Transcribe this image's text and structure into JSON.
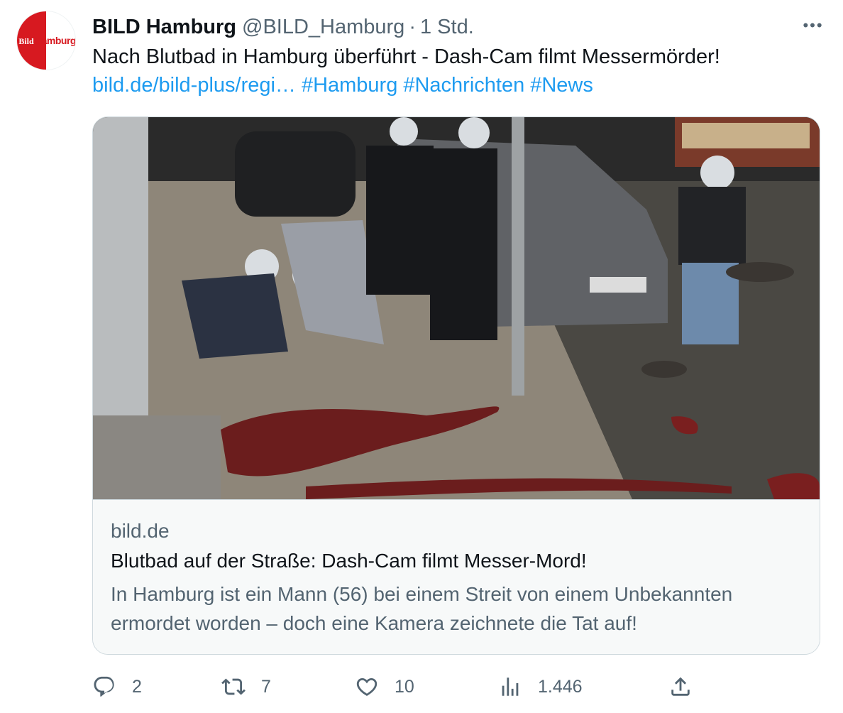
{
  "account": {
    "display_name": "BILD Hamburg",
    "handle": "@BILD_Hamburg",
    "separator": "·",
    "time": "1 Std.",
    "avatar_logo_text": "Bild",
    "avatar_city_text": "Hamburg"
  },
  "more_label": "•••",
  "tweet": {
    "text": "Nach Blutbad in Hamburg überführt - Dash-Cam filmt Messermörder!",
    "link": "bild.de/bild-plus/regi…",
    "hashtags": [
      "#Hamburg",
      "#Nachrichten",
      "#News"
    ]
  },
  "card": {
    "domain": "bild.de",
    "title": "Blutbad auf der Straße: Dash-Cam filmt Messer-Mord!",
    "description": "In Hamburg ist ein Mann (56) bei einem Streit von einem Unbekannten ermordet worden – doch eine Kamera zeichnete die Tat auf!"
  },
  "actions": {
    "replies": "2",
    "retweets": "7",
    "likes": "10",
    "views": "1.446"
  },
  "colors": {
    "link": "#1d9bf0",
    "secondary_text": "#536471",
    "brand_red": "#d71920"
  }
}
